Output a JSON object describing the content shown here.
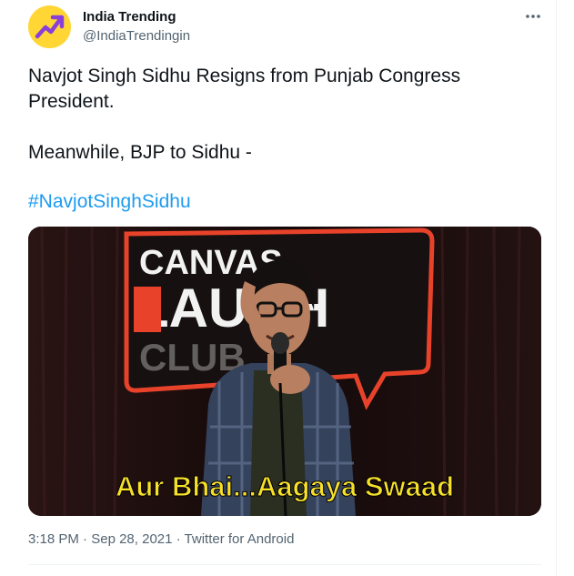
{
  "account": {
    "display_name": "India Trending",
    "handle": "@IndiaTrendingin",
    "avatar_icon": "trending-up-arrow-icon",
    "avatar_color": "#ffd633",
    "avatar_arrow_color": "#8b3fd9"
  },
  "tweet": {
    "line1": "Navjot Singh Sidhu Resigns from Punjab Congress",
    "line2": "President.",
    "line3": "Meanwhile, BJP to Sidhu -",
    "hashtag": "#NavjotSinghSidhu",
    "link_color": "#1d9bf0"
  },
  "media": {
    "sign_line1": "CANVAS",
    "sign_line2": "LAUGH",
    "sign_line3": "CLUB",
    "sign_color": "#e8432a",
    "caption": "Aur Bhai...Aagaya Swaad",
    "caption_color": "#f7e02a"
  },
  "meta": {
    "time": "3:18 PM",
    "separator": " · ",
    "date": "Sep 28, 2021",
    "source": "Twitter for Android"
  },
  "icons": {
    "more": "more-horizontal-icon"
  }
}
